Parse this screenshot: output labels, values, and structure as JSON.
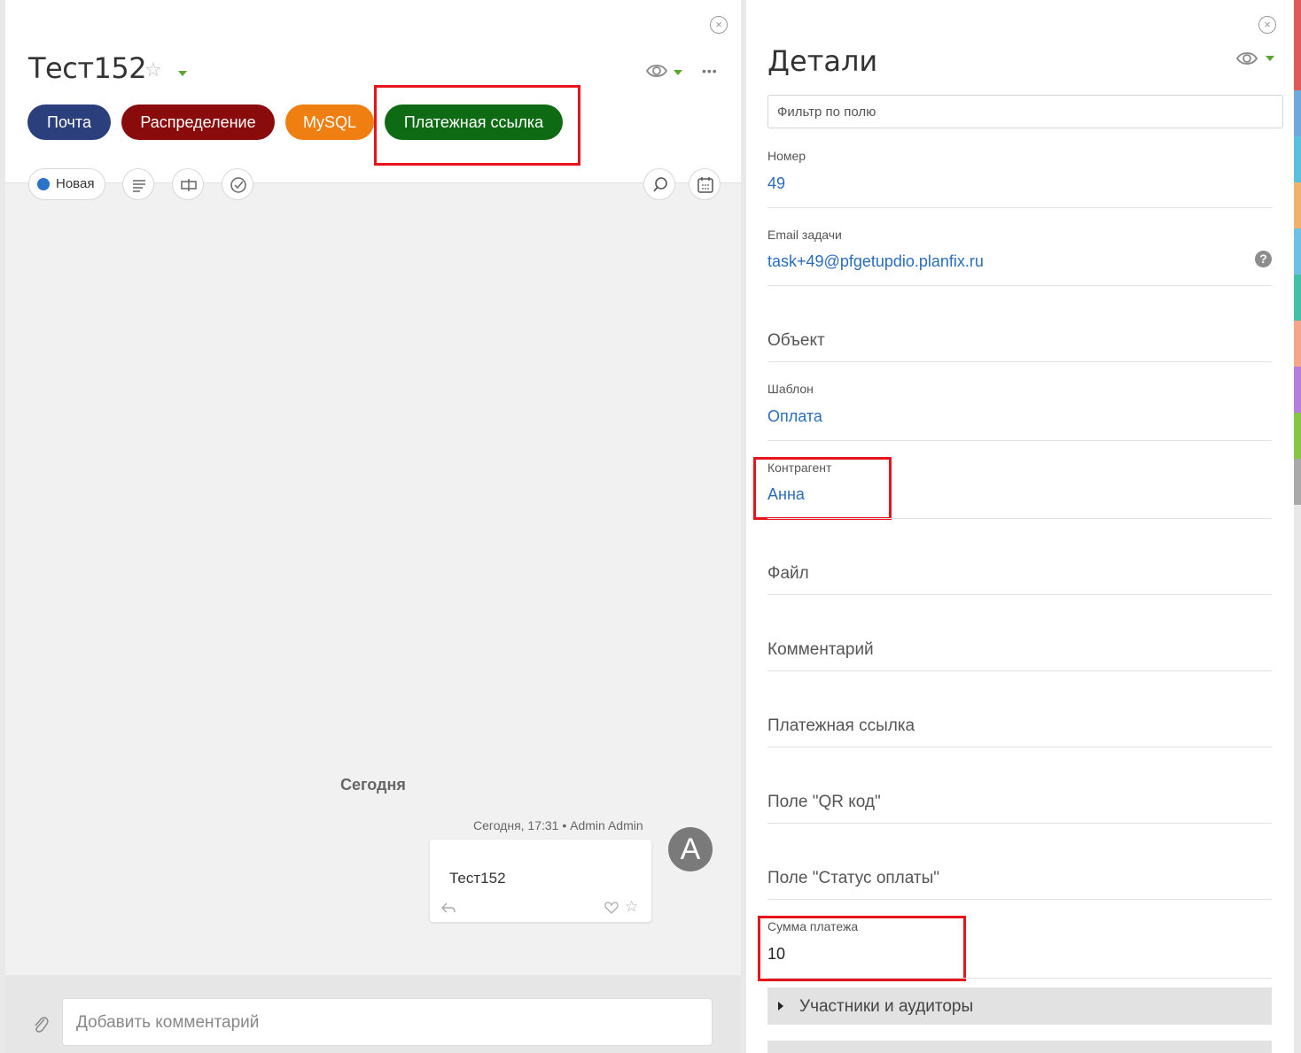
{
  "task": {
    "title": "Тест152",
    "close_icon": "×",
    "more_icon": "•••"
  },
  "action_buttons": [
    {
      "label": "Почта",
      "color": "#2a3f7c"
    },
    {
      "label": "Распределение",
      "color": "#8a0b0b"
    },
    {
      "label": "MySQL",
      "color": "#f07f12"
    },
    {
      "label": "Платежная ссылка",
      "color": "#0f6b13"
    }
  ],
  "toolbar": {
    "status_label": "Новая",
    "status_color": "#2a73c9"
  },
  "chat": {
    "day_label": "Сегодня",
    "message_meta": "Сегодня, 17:31 • Admin Admin",
    "message_text": "Тест152",
    "avatar_letter": "A"
  },
  "composer": {
    "placeholder": "Добавить комментарий"
  },
  "details": {
    "title": "Детали",
    "filter_placeholder": "Фильтр по полю",
    "help_icon": "?",
    "fields": {
      "number_label": "Номер",
      "number_value": "49",
      "email_label": "Email задачи",
      "email_value": "task+49@pfgetupdio.planfix.ru",
      "object_label": "Объект",
      "template_label": "Шаблон",
      "template_value": "Оплата",
      "counterparty_label": "Контрагент",
      "counterparty_value": "Анна",
      "file_label": "Файл",
      "comment_label": "Комментарий",
      "payment_link_label": "Платежная ссылка",
      "qr_label": "Поле \"QR код\"",
      "payment_status_label": "Поле \"Статус оплаты\"",
      "payment_sum_label": "Сумма платежа",
      "payment_sum_value": "10"
    },
    "section_participants": "Участники и аудиторы"
  },
  "colors": {
    "highlight_box": "#e8141b",
    "link": "#2a6dbf",
    "sidebar_strip": [
      "#e05a5a",
      "#6fa8dc",
      "#5bc0de",
      "#f0b26a",
      "#6ec1e4",
      "#45c0a8",
      "#f4a58a",
      "#b57edc",
      "#86c545",
      "#a9a9a9",
      "#e8e8e8"
    ]
  }
}
